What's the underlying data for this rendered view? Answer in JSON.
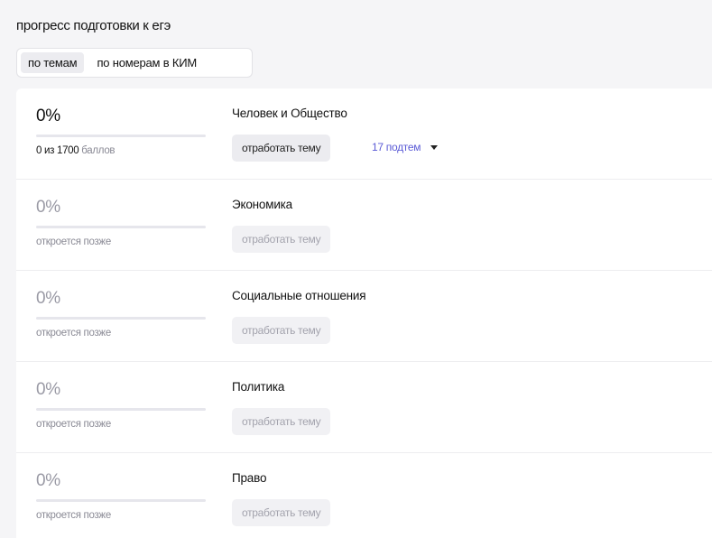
{
  "page": {
    "title": "прогресс подготовки к егэ"
  },
  "tabs": [
    {
      "label": "по темам",
      "active": true
    },
    {
      "label": "по номерам в КИМ",
      "active": false
    }
  ],
  "rows": [
    {
      "percent": "0%",
      "progress": 0,
      "score_prefix": "0 из 1700",
      "score_suffix": " баллов",
      "status": "",
      "topic": "Человек и Общество",
      "button": "отработать тему",
      "subtopics": "17 подтем",
      "locked": false
    },
    {
      "percent": "0%",
      "progress": 0,
      "status": "откроется позже",
      "topic": "Экономика",
      "button": "отработать тему",
      "locked": true
    },
    {
      "percent": "0%",
      "progress": 0,
      "status": "откроется позже",
      "topic": "Социальные отношения",
      "button": "отработать тему",
      "locked": true
    },
    {
      "percent": "0%",
      "progress": 0,
      "status": "откроется позже",
      "topic": "Политика",
      "button": "отработать тему",
      "locked": true
    },
    {
      "percent": "0%",
      "progress": 0,
      "status": "откроется позже",
      "topic": "Право",
      "button": "отработать тему",
      "locked": true
    }
  ],
  "colors": {
    "accent": "#5b5bd6",
    "muted": "#9a9aa5"
  }
}
